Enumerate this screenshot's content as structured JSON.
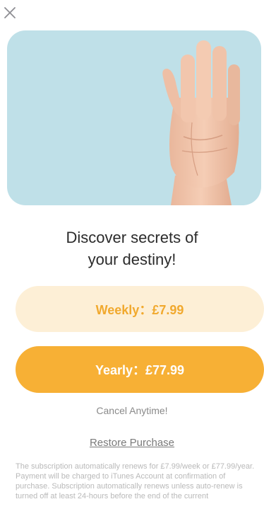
{
  "icons": {
    "close": "close-icon"
  },
  "headline": {
    "line1": "Discover secrets of",
    "line2": "your destiny!"
  },
  "plans": {
    "weekly_label": "Weekly：£7.99",
    "yearly_label": "Yearly：£77.99"
  },
  "cancel_note": "Cancel Anytime!",
  "restore_label": "Restore Purchase",
  "legal_text": "The subscription automatically renews for £7.99/week or £77.99/year. Payment will be charged to iTunes Account at confirmation of purchase. Subscription automatically renews unless auto-renew is turned off at least 24-hours before the end of the current",
  "colors": {
    "hero_background": "#bfe0e8",
    "weekly_background": "#fdefd6",
    "weekly_text": "#f1a92e",
    "yearly_background": "#f7b035",
    "yearly_text": "#ffffff"
  }
}
